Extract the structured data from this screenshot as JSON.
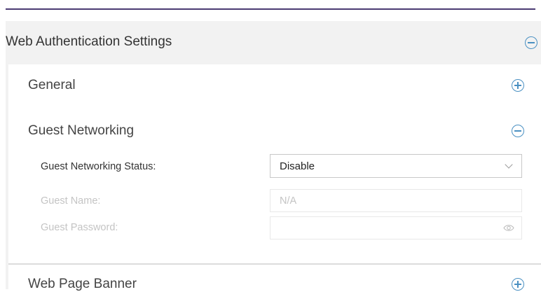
{
  "panel": {
    "title": "Web Authentication Settings",
    "toggle_icon": "collapse-icon"
  },
  "sections": {
    "general": {
      "title": "General",
      "toggle_icon": "expand-icon"
    },
    "guest_networking": {
      "title": "Guest Networking",
      "toggle_icon": "collapse-icon",
      "fields": {
        "status": {
          "label": "Guest Networking Status:",
          "value": "Disable"
        },
        "name": {
          "label": "Guest Name:",
          "value": "N/A"
        },
        "password": {
          "label": "Guest Password:",
          "value": "",
          "icon": "eye-icon"
        }
      }
    },
    "web_page_banner": {
      "title": "Web Page Banner",
      "toggle_icon": "expand-icon"
    }
  },
  "colors": {
    "accent": "#4a90c2",
    "top_rule": "#4b3a73",
    "disabled_text": "#c4c4c4"
  }
}
